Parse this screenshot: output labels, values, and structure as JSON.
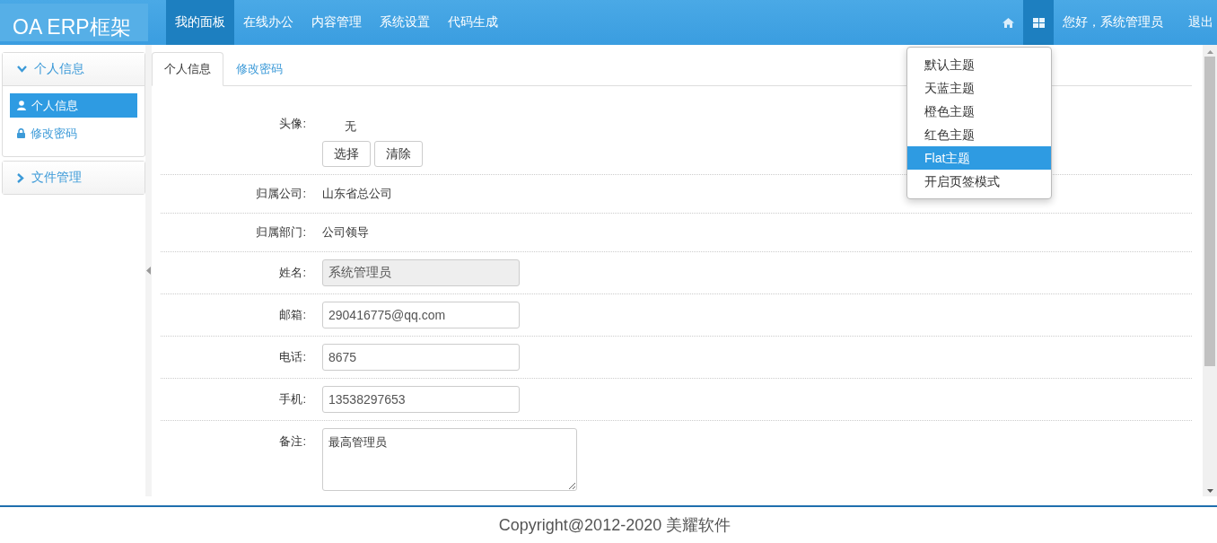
{
  "header": {
    "logo": "OA ERP框架",
    "nav": [
      {
        "label": "我的面板",
        "selected": true
      },
      {
        "label": "在线办公",
        "selected": false
      },
      {
        "label": "内容管理",
        "selected": false
      },
      {
        "label": "系统设置",
        "selected": false
      },
      {
        "label": "代码生成",
        "selected": false
      }
    ],
    "greeting": "您好，系统管理员",
    "logout": "退出",
    "theme_menu": [
      {
        "label": "默认主题",
        "selected": false
      },
      {
        "label": "天蓝主题",
        "selected": false
      },
      {
        "label": "橙色主题",
        "selected": false
      },
      {
        "label": "红色主题",
        "selected": false
      },
      {
        "label": "Flat主题",
        "selected": true
      },
      {
        "label": "开启页签模式",
        "selected": false
      }
    ]
  },
  "sidebar": {
    "groups": [
      {
        "title": "个人信息",
        "expanded": true,
        "items": [
          {
            "label": "个人信息",
            "selected": true
          },
          {
            "label": "修改密码",
            "selected": false
          }
        ]
      },
      {
        "title": "文件管理",
        "expanded": false
      }
    ]
  },
  "tabs": [
    {
      "label": "个人信息",
      "selected": true
    },
    {
      "label": "修改密码",
      "selected": false
    }
  ],
  "form": {
    "rows": [
      {
        "kind": "avatar",
        "label": "头像:",
        "value": "无",
        "buttons": [
          "选择",
          "清除"
        ]
      },
      {
        "kind": "text",
        "label": "归属公司:",
        "value": "山东省总公司"
      },
      {
        "kind": "text",
        "label": "归属部门:",
        "value": "公司领导"
      },
      {
        "kind": "input",
        "label": "姓名:",
        "value": "系统管理员",
        "disabled": true
      },
      {
        "kind": "input",
        "label": "邮箱:",
        "value": "290416775@qq.com",
        "disabled": false
      },
      {
        "kind": "input",
        "label": "电话:",
        "value": "8675",
        "disabled": false
      },
      {
        "kind": "input",
        "label": "手机:",
        "value": "13538297653",
        "disabled": false
      },
      {
        "kind": "textarea",
        "label": "备注:",
        "value": "最高管理员"
      }
    ]
  },
  "footer": {
    "copyright": "Copyright@2012-2020 美耀软件"
  }
}
